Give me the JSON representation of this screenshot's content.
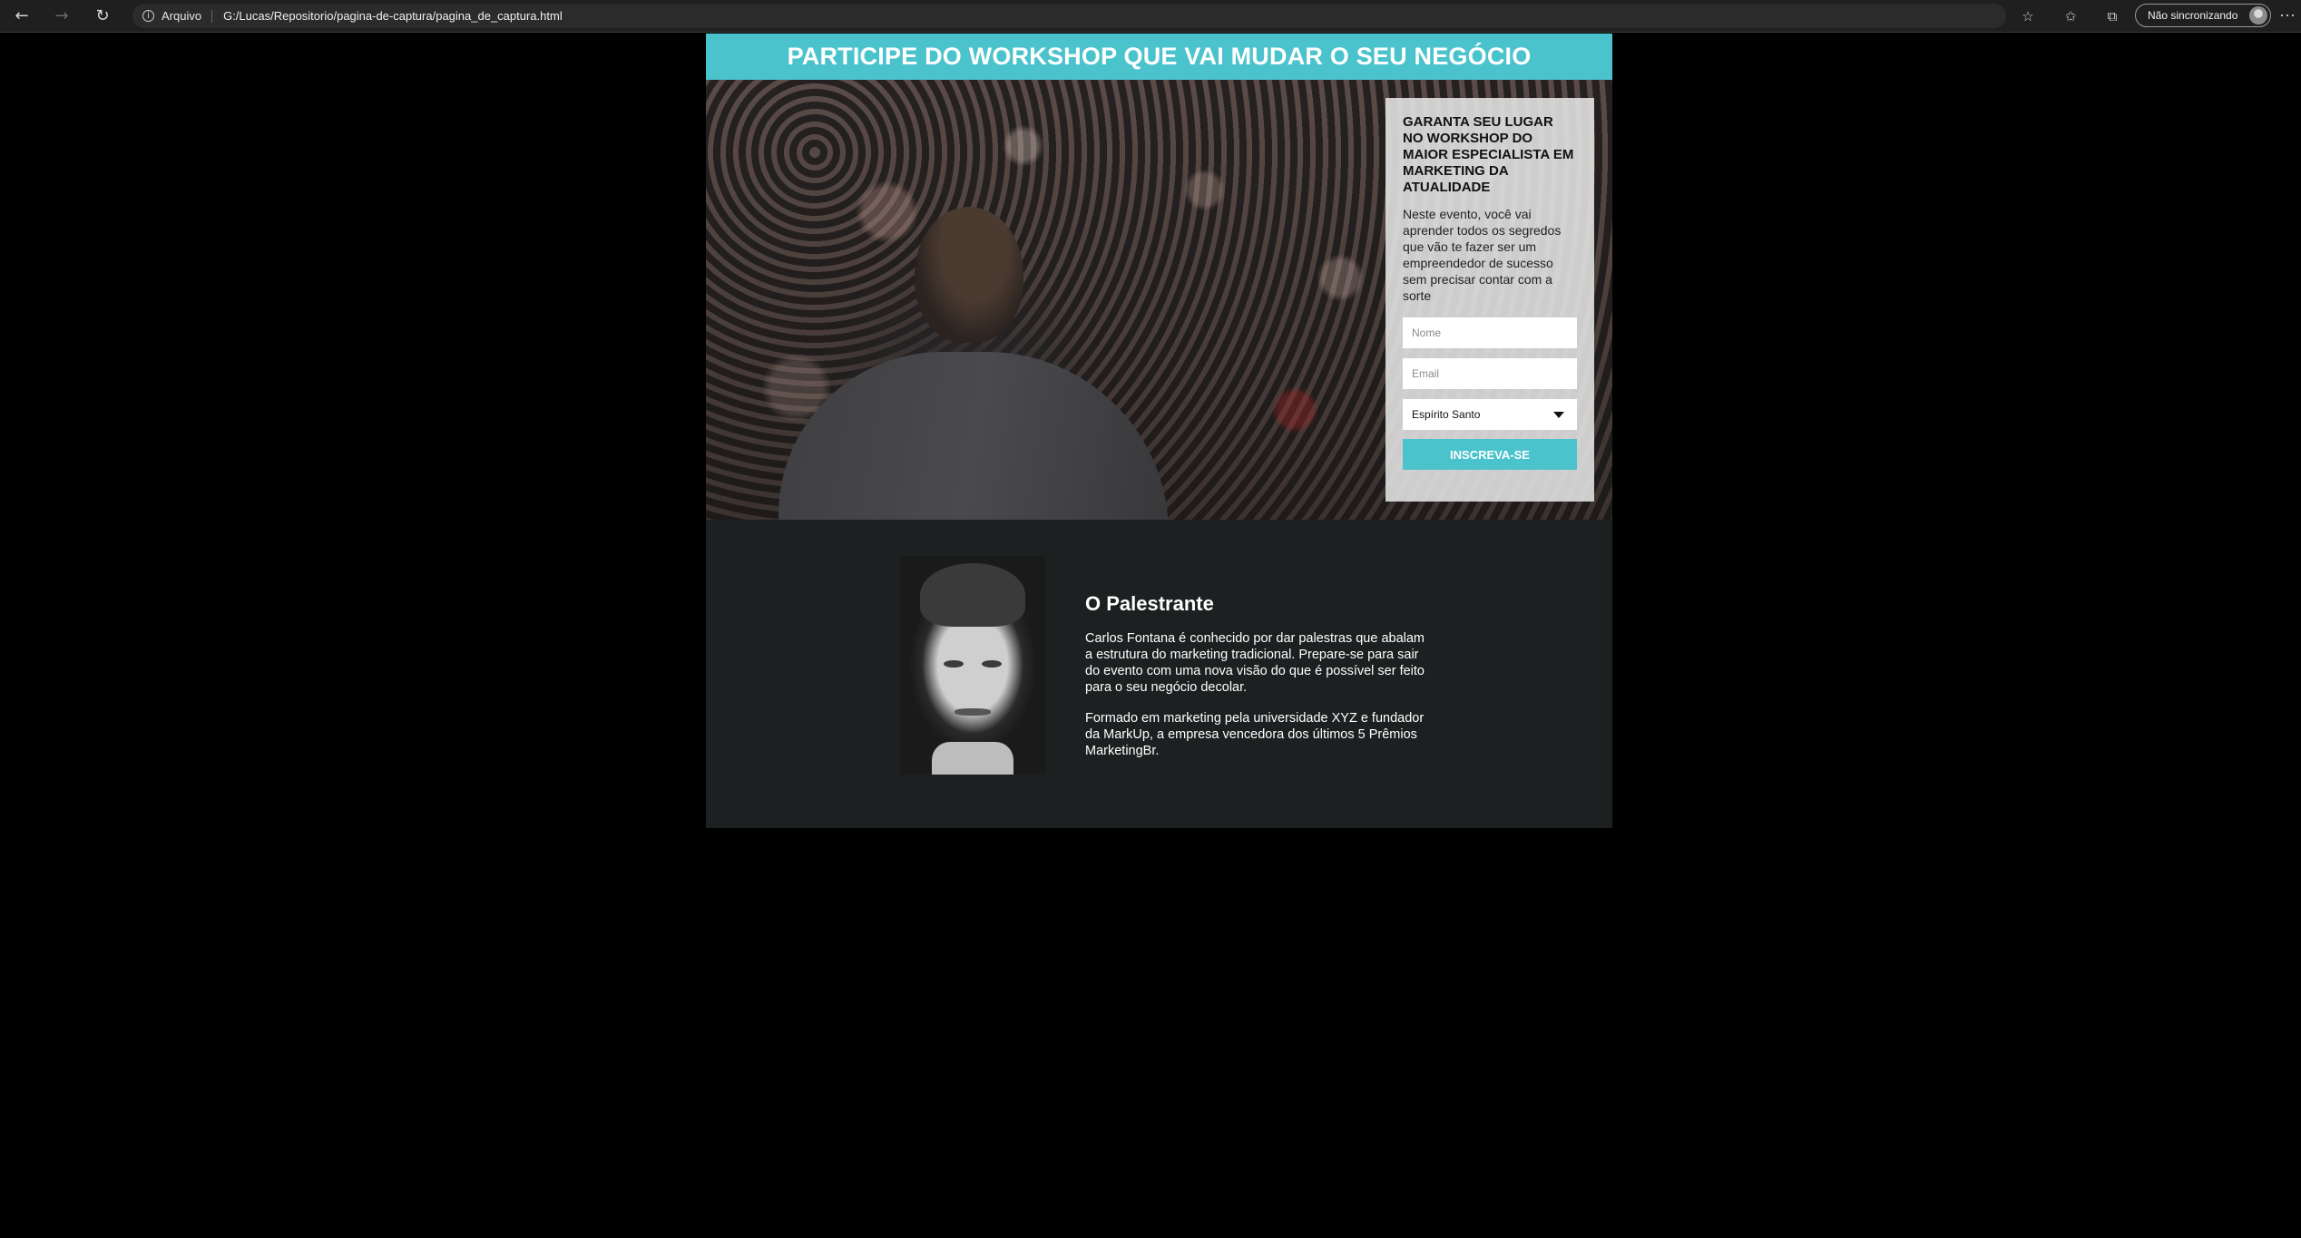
{
  "browser": {
    "security_label": "Arquivo",
    "url": "G:/Lucas/Repositorio/pagina-de-captura/pagina_de_captura.html",
    "sync_label": "Não sincronizando"
  },
  "banner": {
    "title": "PARTICIPE DO WORKSHOP QUE VAI MUDAR O SEU NEGÓCIO"
  },
  "form": {
    "heading": "GARANTA SEU LUGAR NO WORKSHOP DO MAIOR ESPECIALISTA EM MARKETING DA ATUALIDADE",
    "description": "Neste evento, você vai aprender todos os segredos que vão te fazer ser um empreendedor de sucesso sem precisar contar com a sorte",
    "name_placeholder": "Nome",
    "email_placeholder": "Email",
    "state_selected": "Espírito Santo",
    "submit_label": "INSCREVA-SE"
  },
  "speaker": {
    "title": "O Palestrante",
    "paragraph_1": "Carlos Fontana é conhecido por dar palestras que abalam a estrutura do marketing tradicional. Prepare-se para sair do evento com uma nova visão do que é possível ser feito para o seu negócio decolar.",
    "paragraph_2": "Formado em marketing pela universidade XYZ e fundador da MarkUp, a empresa vencedora dos últimos 5 Prêmios MarketingBr."
  },
  "colors": {
    "accent": "#4bc3cc",
    "about_background": "#1d2021",
    "page_background": "#000000"
  }
}
